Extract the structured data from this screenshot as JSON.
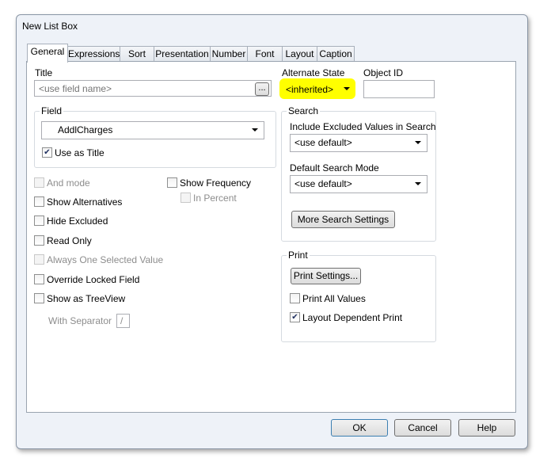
{
  "window": {
    "title": "New List Box"
  },
  "tabs": [
    "General",
    "Expressions",
    "Sort",
    "Presentation",
    "Number",
    "Font",
    "Layout",
    "Caption"
  ],
  "general": {
    "title_label": "Title",
    "title_placeholder": "<use field name>",
    "title_button": "...",
    "field_group": "Field",
    "field_value": "AddlCharges",
    "use_as_title": "Use as Title",
    "checkboxes": [
      {
        "label": "And mode",
        "checked": false,
        "disabled": true
      },
      {
        "label": "Show Alternatives",
        "checked": false,
        "disabled": false
      },
      {
        "label": "Hide Excluded",
        "checked": false,
        "disabled": false
      },
      {
        "label": "Read Only",
        "checked": false,
        "disabled": false
      },
      {
        "label": "Always One Selected Value",
        "checked": false,
        "disabled": true
      },
      {
        "label": "Override Locked Field",
        "checked": false,
        "disabled": false
      },
      {
        "label": "Show as TreeView",
        "checked": false,
        "disabled": false
      }
    ],
    "show_frequency": "Show Frequency",
    "in_percent": "In Percent",
    "with_separator": "With Separator",
    "separator_value": "/",
    "alternate_state_label": "Alternate State",
    "alternate_state_value": "<inherited>",
    "highlight": "#ffff00",
    "object_id_label": "Object ID",
    "search_group": "Search",
    "include_excluded_label": "Include Excluded Values in Search",
    "include_excluded_value": "<use default>",
    "default_search_label": "Default Search Mode",
    "default_search_value": "<use default>",
    "more_search": "More Search Settings",
    "print_group": "Print",
    "print_settings": "Print Settings...",
    "print_all": "Print All Values",
    "layout_dependent": "Layout Dependent Print"
  },
  "buttons": {
    "ok": "OK",
    "cancel": "Cancel",
    "help": "Help"
  }
}
